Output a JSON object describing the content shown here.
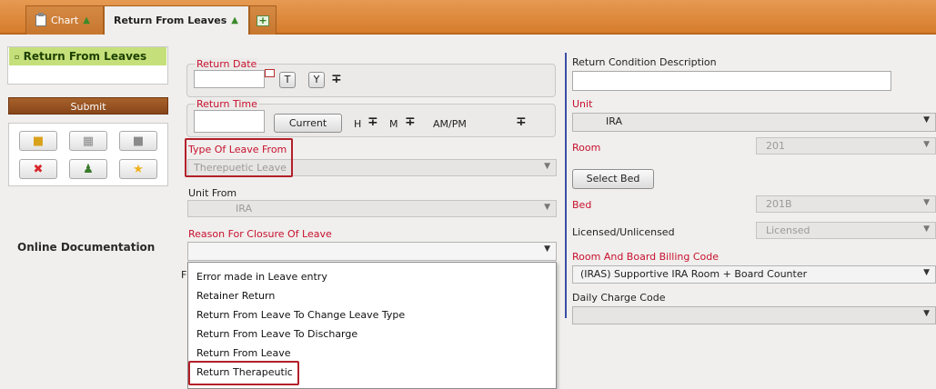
{
  "tabs": {
    "chart": "Chart",
    "active": "Return From Leaves"
  },
  "sidebar": {
    "nav_item": "Return From Leaves",
    "submit": "Submit",
    "online_documentation": "Online Documentation"
  },
  "form": {
    "return_date": {
      "legend": "Return Date",
      "today_button": "T",
      "yesterday_button": "Y"
    },
    "return_time": {
      "legend": "Return Time",
      "current_button": "Current",
      "hour_label": "H",
      "minute_label": "M",
      "ampm_label": "AM/PM"
    },
    "type_of_leave_from": {
      "label": "Type Of Leave From",
      "value": "Therepuetic Leave"
    },
    "unit_from": {
      "label": "Unit From",
      "value": "IRA"
    },
    "reason_for_closure": {
      "label": "Reason For Closure Of Leave",
      "value": ""
    },
    "hidden_label_letter": "F",
    "dropdown_options": [
      "Error made in Leave entry",
      "Retainer Return",
      "Return From Leave To Change Leave Type",
      "Return From Leave To Discharge",
      "Return From Leave",
      "Return Therapeutic"
    ]
  },
  "right": {
    "return_condition": {
      "label": "Return Condition Description",
      "value": ""
    },
    "unit": {
      "label": "Unit",
      "value": "IRA"
    },
    "room": {
      "label": "Room",
      "value": "201"
    },
    "select_bed_button": "Select Bed",
    "bed": {
      "label": "Bed",
      "value": "201B"
    },
    "licensed": {
      "label": "Licensed/Unlicensed",
      "value": "Licensed"
    },
    "billing_code": {
      "label": "Room And Board Billing Code",
      "value": "(IRAS) Supportive IRA Room + Board Counter"
    },
    "daily_charge": {
      "label": "Daily Charge Code",
      "value": ""
    }
  },
  "colors": {
    "topbar": "#d67c2c",
    "required_label": "#c8102e",
    "nav_highlight": "#c5e07a",
    "submit_bg": "#874519",
    "divider": "#3b4ea6",
    "annotation": "#b3202a"
  }
}
